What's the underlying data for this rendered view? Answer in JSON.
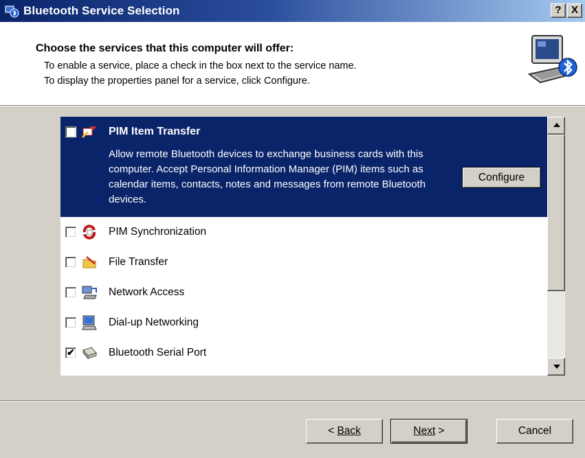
{
  "window": {
    "title": "Bluetooth Service Selection",
    "help_label": "?",
    "close_label": "X"
  },
  "header": {
    "title": "Choose the services that this computer will offer:",
    "desc1": "To enable a service, place a check in the box next to the service name.",
    "desc2": "To display the properties panel for a service, click Configure."
  },
  "services": {
    "selected": {
      "label": "PIM Item Transfer",
      "description": "Allow remote Bluetooth devices to exchange business cards with this computer. Accept Personal Information Manager (PIM) items such as calendar items, contacts, notes and messages from remote Bluetooth devices.",
      "checked": false,
      "configure_label": "Configure"
    },
    "items": [
      {
        "label": "PIM Synchronization",
        "checked": false,
        "icon": "sync-icon"
      },
      {
        "label": "File Transfer",
        "checked": false,
        "icon": "file-transfer-icon"
      },
      {
        "label": "Network Access",
        "checked": false,
        "icon": "network-icon"
      },
      {
        "label": "Dial-up Networking",
        "checked": false,
        "icon": "dialup-icon"
      },
      {
        "label": "Bluetooth Serial Port",
        "checked": true,
        "icon": "serial-port-icon"
      }
    ]
  },
  "buttons": {
    "back": "Back",
    "back_prefix": "< ",
    "next": "Next",
    "next_suffix": " >",
    "cancel": "Cancel"
  },
  "colors": {
    "selection": "#0a246a",
    "dialog_bg": "#d4d0c8"
  }
}
